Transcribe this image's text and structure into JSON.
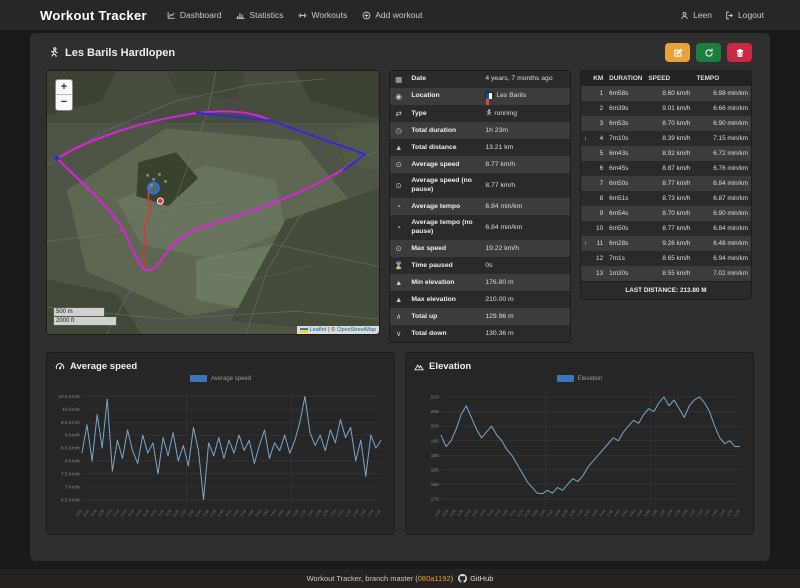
{
  "navbar": {
    "brand": "Workout Tracker",
    "items": [
      {
        "label": "Dashboard",
        "icon": "dashboard-chart-icon"
      },
      {
        "label": "Statistics",
        "icon": "statistics-bars-icon"
      },
      {
        "label": "Workouts",
        "icon": "workouts-dumbbell-icon"
      },
      {
        "label": "Add workout",
        "icon": "add-workout-icon"
      }
    ],
    "user": "Leen",
    "logout": "Logout"
  },
  "page": {
    "title": "Les Barils Hardlopen"
  },
  "actions": {
    "edit_color": "#e9a23b",
    "refresh_color": "#1d7c40",
    "delete_color": "#c82843"
  },
  "map": {
    "zoom_in": "+",
    "zoom_out": "−",
    "scale_m": "500 m",
    "scale_ft": "2000 ft",
    "attribution_leaflet": "Leaflet",
    "attribution_sep": " | © ",
    "attribution_osm": "OpenStreetMap"
  },
  "details": {
    "rows": [
      {
        "icon": "calendar-icon",
        "glyph": "▦",
        "label": "Date",
        "value": "4 years, 7 months ago"
      },
      {
        "icon": "location-icon",
        "glyph": "◉",
        "label": "Location",
        "value": "Les Barils",
        "flag": "fr"
      },
      {
        "icon": "type-icon",
        "glyph": "⇄",
        "label": "Type",
        "value": "running",
        "value_icon": "running-icon"
      },
      {
        "icon": "clock-icon",
        "glyph": "◷",
        "label": "Total duration",
        "value": "1h 23m"
      },
      {
        "icon": "distance-icon",
        "glyph": "▲",
        "label": "Total distance",
        "value": "13.21 km"
      },
      {
        "icon": "gauge-icon",
        "glyph": "⊙",
        "label": "Average speed",
        "value": "8.77 km/h"
      },
      {
        "icon": "gauge-icon",
        "glyph": "⊙",
        "label": "Average speed (no pause)",
        "value": "8.77 km/h"
      },
      {
        "icon": "stopwatch-icon",
        "glyph": "◔",
        "label": "Average tempo",
        "value": "6.84 min/km"
      },
      {
        "icon": "stopwatch-icon",
        "glyph": "◔",
        "label": "Average tempo (no pause)",
        "value": "6.84 min/km"
      },
      {
        "icon": "gauge-icon",
        "glyph": "⊙",
        "label": "Max speed",
        "value": "19.22 km/h"
      },
      {
        "icon": "hourglass-icon",
        "glyph": "⌛",
        "label": "Time paused",
        "value": "0s"
      },
      {
        "icon": "mountain-icon",
        "glyph": "▲",
        "label": "Min elevation",
        "value": "176.80 m"
      },
      {
        "icon": "mountain-icon",
        "glyph": "▲",
        "label": "Max elevation",
        "value": "210.00 m"
      },
      {
        "icon": "chevron-up-icon",
        "glyph": "∧",
        "label": "Total up",
        "value": "129.96 m"
      },
      {
        "icon": "chevron-down-icon",
        "glyph": "∨",
        "label": "Total down",
        "value": "130.36 m"
      }
    ]
  },
  "splits": {
    "headers": [
      "KM",
      "DURATION",
      "SPEED",
      "TEMPO"
    ],
    "rows": [
      {
        "km": "1",
        "duration": "6m58s",
        "speed": "8.60 km/h",
        "tempo": "6.98 min/km",
        "trend": ""
      },
      {
        "km": "2",
        "duration": "6m39s",
        "speed": "9.01 km/h",
        "tempo": "6.66 min/km",
        "trend": ""
      },
      {
        "km": "3",
        "duration": "6m53s",
        "speed": "8.70 km/h",
        "tempo": "6.90 min/km",
        "trend": ""
      },
      {
        "km": "4",
        "duration": "7m10s",
        "speed": "8.39 km/h",
        "tempo": "7.15 min/km",
        "trend": "down"
      },
      {
        "km": "5",
        "duration": "6m43s",
        "speed": "8.92 km/h",
        "tempo": "6.72 min/km",
        "trend": ""
      },
      {
        "km": "6",
        "duration": "6m45s",
        "speed": "8.87 km/h",
        "tempo": "6.76 min/km",
        "trend": ""
      },
      {
        "km": "7",
        "duration": "6m50s",
        "speed": "8.77 km/h",
        "tempo": "6.84 min/km",
        "trend": ""
      },
      {
        "km": "8",
        "duration": "6m51s",
        "speed": "8.73 km/h",
        "tempo": "6.87 min/km",
        "trend": ""
      },
      {
        "km": "9",
        "duration": "6m54s",
        "speed": "8.70 km/h",
        "tempo": "6.90 min/km",
        "trend": ""
      },
      {
        "km": "10",
        "duration": "6m50s",
        "speed": "8.77 km/h",
        "tempo": "6.84 min/km",
        "trend": ""
      },
      {
        "km": "11",
        "duration": "6m28s",
        "speed": "9.26 km/h",
        "tempo": "6.48 min/km",
        "trend": "up"
      },
      {
        "km": "12",
        "duration": "7m1s",
        "speed": "8.65 km/h",
        "tempo": "6.94 min/km",
        "trend": ""
      },
      {
        "km": "13",
        "duration": "1m30s",
        "speed": "8.55 km/h",
        "tempo": "7.02 min/km",
        "trend": ""
      }
    ],
    "footer": "LAST DISTANCE: 213.80 M"
  },
  "chart_data": [
    {
      "type": "line",
      "title": "Average speed",
      "title_icon": "gauge-chart-icon",
      "legend": [
        "Average speed"
      ],
      "legend_position": "top-center",
      "line_color": "#7aa6cc",
      "legend_color": "#3f74b8",
      "grid": true,
      "ylim": [
        6.3,
        10.7
      ],
      "yticks": [
        6.5,
        7,
        7.5,
        8,
        8.5,
        9,
        9.5,
        10,
        10.5
      ],
      "ytick_labels": [
        "6.5 km/h",
        "7 km/h",
        "7.5 km/h",
        "8 km/h",
        "8.5 km/h",
        "9 km/h",
        "9.5 km/h",
        "10 km/h",
        "10.5 km/h"
      ],
      "x_ticks": [
        "0:02",
        "0:04",
        "0:06",
        "0:08",
        "0:10",
        "0:12",
        "0:14",
        "0:16",
        "0:18",
        "0:20",
        "0:22",
        "0:24",
        "0:26",
        "0:28",
        "0:30",
        "0:32",
        "0:34",
        "0:36",
        "0:38",
        "0:40",
        "0:42",
        "0:44",
        "0:46",
        "0:48",
        "0:50",
        "0:52",
        "0:54",
        "0:56",
        "0:58",
        "1:00",
        "1:02",
        "1:04",
        "1:06",
        "1:08",
        "1:10",
        "1:12",
        "1:14",
        "1:16",
        "1:18",
        "1:20",
        "1:22"
      ],
      "values": [
        8.3,
        9.4,
        8.0,
        9.8,
        8.5,
        10.4,
        7.6,
        8.8,
        8.1,
        9.2,
        8.4,
        7.9,
        9.0,
        8.3,
        8.7,
        7.5,
        8.9,
        8.2,
        9.1,
        8.0,
        8.6,
        7.8,
        9.3,
        8.4,
        6.5,
        8.7,
        8.2,
        8.9,
        8.1,
        8.8,
        8.3,
        9.0,
        8.4,
        8.8,
        7.9,
        8.6,
        9.2,
        8.1,
        8.7,
        8.4,
        9.0,
        8.3,
        8.8,
        9.5,
        10.5,
        9.1,
        8.6,
        9.0,
        8.4,
        9.2,
        8.7,
        9.6,
        8.9,
        9.3,
        8.0,
        8.8,
        7.4,
        9.0,
        8.5,
        8.8
      ]
    },
    {
      "type": "line",
      "title": "Elevation",
      "title_icon": "mountain-chart-icon",
      "legend": [
        "Elevation"
      ],
      "legend_position": "top-center",
      "line_color": "#7aa6cc",
      "legend_color": "#3f74b8",
      "grid": true,
      "ylim": [
        173,
        212
      ],
      "yticks": [
        175,
        180,
        185,
        190,
        195,
        200,
        205,
        210
      ],
      "ytick_labels": [
        "175",
        "180",
        "185",
        "190",
        "195",
        "200",
        "205",
        "210"
      ],
      "x_ticks": [
        "0:02",
        "0:04",
        "0:06",
        "0:08",
        "0:10",
        "0:12",
        "0:14",
        "0:16",
        "0:18",
        "0:20",
        "0:22",
        "0:24",
        "0:26",
        "0:28",
        "0:30",
        "0:32",
        "0:34",
        "0:36",
        "0:38",
        "0:40",
        "0:42",
        "0:44",
        "0:46",
        "0:48",
        "0:50",
        "0:52",
        "0:54",
        "0:56",
        "0:58",
        "1:00",
        "1:02",
        "1:04",
        "1:06",
        "1:08",
        "1:10",
        "1:12",
        "1:14",
        "1:16",
        "1:18",
        "1:20",
        "1:22"
      ],
      "values": [
        197,
        193,
        195,
        199,
        204,
        207,
        203,
        199,
        196,
        198,
        200,
        197,
        195,
        192,
        190,
        187,
        184,
        181,
        179,
        177,
        176.8,
        178,
        177,
        179,
        178,
        180,
        182,
        181,
        183,
        186,
        188,
        190,
        192,
        194,
        196,
        195,
        198,
        200,
        202,
        201,
        204,
        206,
        205,
        208,
        210,
        207,
        209,
        206,
        203,
        207,
        209,
        210,
        208,
        205,
        200,
        196,
        194,
        195,
        193,
        193
      ]
    }
  ],
  "footer": {
    "prefix": "Workout Tracker, branch master (",
    "hash": "080a1192",
    "suffix": ")",
    "github_label": "GitHub"
  }
}
